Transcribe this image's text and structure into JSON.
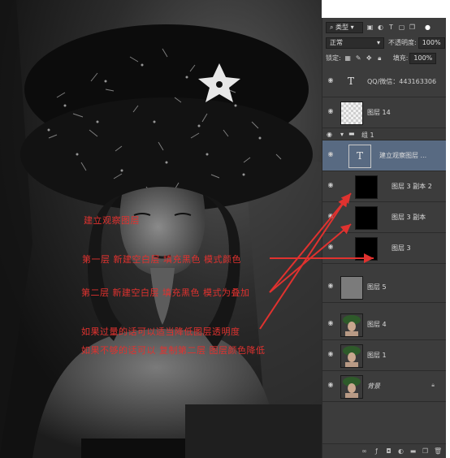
{
  "layers_panel": {
    "toolbar": {
      "filter_kind": "类型",
      "blend_mode": "正常",
      "opacity_label": "不透明度:",
      "opacity_value": "100%",
      "lock_label": "锁定:",
      "fill_label": "填充:",
      "fill_value": "100%"
    },
    "layers": [
      {
        "name": "QQ/微信：443163306",
        "type": "text",
        "icon": "text-layer-icon"
      },
      {
        "name": "图层 14",
        "type": "transparent"
      },
      {
        "name": "建立观察图层 ...",
        "type": "text",
        "icon": "text-layer-icon",
        "selected": true
      },
      {
        "name": "图层 3 副本 2",
        "type": "black"
      },
      {
        "name": "图层 3 副本",
        "type": "black"
      },
      {
        "name": "图层 3",
        "type": "black"
      },
      {
        "name": "图层 5",
        "type": "gray"
      },
      {
        "name": "图层 4",
        "type": "photo"
      },
      {
        "name": "图层 1",
        "type": "photo"
      },
      {
        "name": "背景",
        "type": "photo",
        "locked": true
      }
    ],
    "group": {
      "name": "组 1"
    }
  },
  "annotations": {
    "line1": "建立观察图层",
    "line2": "第一层  新建空白层  填充黑色  模式颜色",
    "line3": "第二层  新建空白层  填充黑色  模式为叠加",
    "line4": "如果过量的话可以适当降低图层透明度",
    "line5": "如果不够的话可以  复制第二层  图层颜色降低"
  },
  "colors": {
    "annotation_red": "#e0322f",
    "panel_bg": "#3c3c3c",
    "selected_row": "#586a82"
  }
}
